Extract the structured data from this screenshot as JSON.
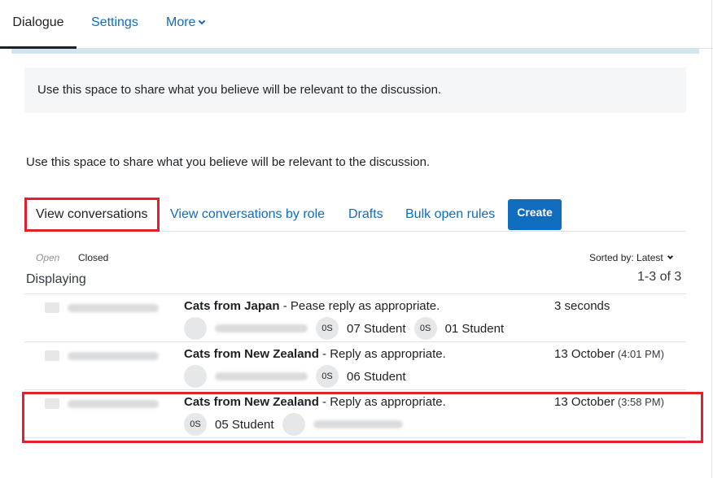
{
  "top_tabs": {
    "dialogue": "Dialogue",
    "settings": "Settings",
    "more": "More"
  },
  "intro": {
    "box_text": "Use this space to share what you believe will be relevant to the discussion.",
    "plain_text": "Use this space to share what you believe will be relevant to the discussion."
  },
  "conv_tabs": {
    "view_conversations": "View conversations",
    "view_by_role": "View conversations by role",
    "drafts": "Drafts",
    "bulk_open_rules": "Bulk open rules",
    "create": "Create"
  },
  "filters": {
    "open": "Open",
    "closed": "Closed"
  },
  "sort": {
    "label": "Sorted by: Latest"
  },
  "list": {
    "displaying": "Displaying",
    "count": "1-3 of 3",
    "rows": [
      {
        "subject": "Cats from Japan",
        "message": " - Pease reply as appropriate.",
        "date": "3 seconds",
        "time": "",
        "participants": [
          {
            "initials": "",
            "name": ""
          },
          {
            "initials": "0S",
            "name": "07 Student"
          },
          {
            "initials": "0S",
            "name": "01 Student"
          }
        ]
      },
      {
        "subject": "Cats from New Zealand",
        "message": " - Reply as appropriate.",
        "date": "13 October",
        "time": " (4:01 PM)",
        "participants": [
          {
            "initials": "",
            "name": ""
          },
          {
            "initials": "0S",
            "name": "06 Student"
          }
        ]
      },
      {
        "subject": "Cats from New Zealand",
        "message": " - Reply as appropriate.",
        "date": "13 October",
        "time": " (3:58 PM)",
        "participants": [
          {
            "initials": "0S",
            "name": "05 Student"
          },
          {
            "initials": "",
            "name": ""
          }
        ]
      }
    ]
  },
  "colors": {
    "link": "#0f6cbf",
    "primary_button": "#0f6cbf",
    "highlight_border": "#e0202b",
    "intro_background": "#f5f6f7",
    "accent_bar": "#cfe6ec"
  }
}
